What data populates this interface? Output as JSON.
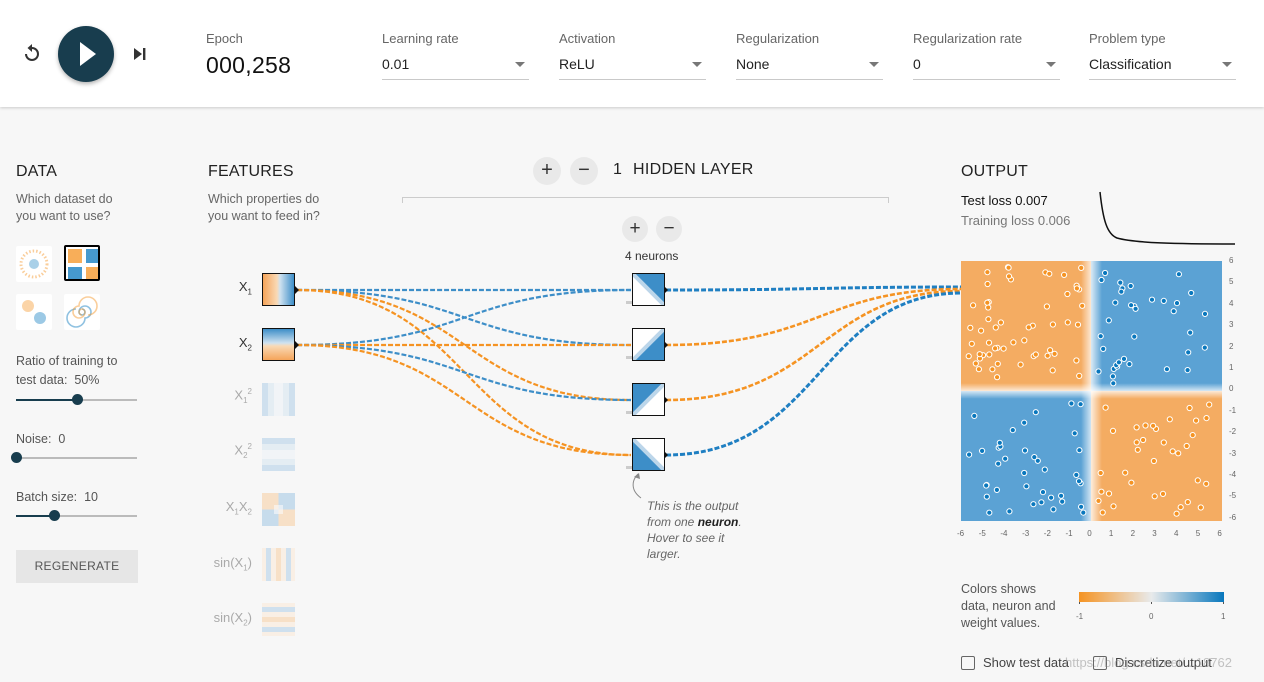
{
  "top": {
    "epoch_label": "Epoch",
    "epoch_value": "000,258",
    "selects": [
      {
        "label": "Learning rate",
        "value": "0.01"
      },
      {
        "label": "Activation",
        "value": "ReLU"
      },
      {
        "label": "Regularization",
        "value": "None"
      },
      {
        "label": "Regularization rate",
        "value": "0"
      },
      {
        "label": "Problem type",
        "value": "Classification"
      }
    ]
  },
  "data": {
    "title": "DATA",
    "question_1": "Which dataset do",
    "question_2": "you want to use?",
    "ratio_label_1": "Ratio of training to",
    "ratio_label_2": "test data:",
    "ratio_value": "50%",
    "ratio_fraction": 0.5,
    "noise_label": "Noise:",
    "noise_value": "0",
    "noise_fraction": 0,
    "batch_label": "Batch size:",
    "batch_value": "10",
    "batch_fraction": 0.31,
    "regenerate": "REGENERATE"
  },
  "features": {
    "title": "FEATURES",
    "question_1": "Which properties do",
    "question_2": "you want to feed in?"
  },
  "hidden": {
    "plus": "+",
    "minus": "−",
    "count": "1",
    "label": "HIDDEN LAYER",
    "neurons_label": "4 neurons"
  },
  "annotation": {
    "part1": "This is the output from one",
    "bold": "neuron",
    "part2": ". Hover to see it larger."
  },
  "output": {
    "title": "OUTPUT",
    "test_loss_label": "Test loss",
    "test_loss_value": "0.007",
    "train_loss_label": "Training loss",
    "train_loss_value": "0.006",
    "y_ticks": [
      "6",
      "5",
      "4",
      "3",
      "2",
      "1",
      "0",
      "-1",
      "-2",
      "-3",
      "-4",
      "-5",
      "-6"
    ],
    "x_ticks": [
      "-6",
      "-5",
      "-4",
      "-3",
      "-2",
      "-1",
      "0",
      "1",
      "2",
      "3",
      "4",
      "5",
      "6"
    ],
    "colors_text_1": "Colors shows",
    "colors_text_2": "data, neuron and",
    "colors_text_3": "weight values.",
    "scale_min": "-1",
    "scale_mid": "0",
    "scale_max": "1",
    "show_test": "Show test data",
    "discretize": "Discretize output"
  },
  "watermark": "https://blog.csdn.net/...18762",
  "colors": {
    "orange": "#f59322",
    "blue": "#0877bd",
    "dark": "#183d4e"
  }
}
